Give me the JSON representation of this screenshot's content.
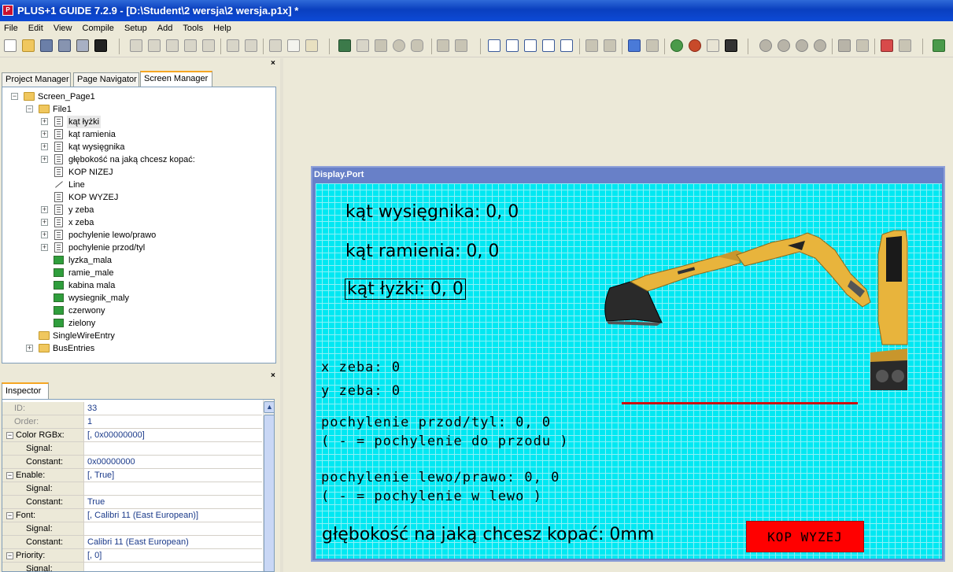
{
  "window": {
    "title": "PLUS+1 GUIDE 7.2.9  - [D:\\Student\\2 wersja\\2 wersja.p1x] *",
    "app_icon": "P"
  },
  "menu": [
    "File",
    "Edit",
    "View",
    "Compile",
    "Setup",
    "Add",
    "Tools",
    "Help"
  ],
  "panel": {
    "close_glyph": "×"
  },
  "tabs": [
    "Project Manager",
    "Page Navigator",
    "Screen Manager"
  ],
  "tree": {
    "root": "Screen_Page1",
    "file": "File1",
    "items": [
      {
        "label": "kąt łyżki",
        "icon": "text-icon",
        "expandable": true
      },
      {
        "label": "kąt ramienia",
        "icon": "text-icon",
        "expandable": true
      },
      {
        "label": "kąt wysięgnika",
        "icon": "text-icon",
        "expandable": true
      },
      {
        "label": "głębokość na jaką chcesz kopać:",
        "icon": "text-icon",
        "expandable": true
      },
      {
        "label": "KOP NIZEJ",
        "icon": "text-icon",
        "expandable": false
      },
      {
        "label": "Line",
        "icon": "line-icon",
        "expandable": false
      },
      {
        "label": "KOP WYZEJ",
        "icon": "text-icon",
        "expandable": false
      },
      {
        "label": "y zeba",
        "icon": "text-icon",
        "expandable": true
      },
      {
        "label": "x zeba",
        "icon": "text-icon",
        "expandable": true
      },
      {
        "label": "pochylenie lewo/prawo",
        "icon": "text-icon",
        "expandable": true
      },
      {
        "label": "pochylenie przod/tyl",
        "icon": "text-icon",
        "expandable": true
      },
      {
        "label": "lyzka_mala",
        "icon": "image-icon",
        "expandable": false
      },
      {
        "label": "ramie_male",
        "icon": "image-icon",
        "expandable": false
      },
      {
        "label": "kabina mala",
        "icon": "image-icon",
        "expandable": false
      },
      {
        "label": "wysiegnik_maly",
        "icon": "image-icon",
        "expandable": false
      },
      {
        "label": "czerwony",
        "icon": "image-icon",
        "expandable": false
      },
      {
        "label": "zielony",
        "icon": "image-icon",
        "expandable": false
      }
    ],
    "single_wire": "SingleWireEntry",
    "bus": "BusEntries"
  },
  "inspector": {
    "tab": "Inspector",
    "rows": [
      {
        "key": "ID:",
        "value": "33",
        "type": "grey"
      },
      {
        "key": "Order:",
        "value": "1",
        "type": "grey"
      },
      {
        "key": "Color RGBx:",
        "value": "[, 0x00000000]",
        "type": "group"
      },
      {
        "key": "Signal:",
        "value": "",
        "type": "sub"
      },
      {
        "key": "Constant:",
        "value": "0x00000000",
        "type": "sub"
      },
      {
        "key": "Enable:",
        "value": "[, True]",
        "type": "group"
      },
      {
        "key": "Signal:",
        "value": "",
        "type": "sub"
      },
      {
        "key": "Constant:",
        "value": "True",
        "type": "sub"
      },
      {
        "key": "Font:",
        "value": "[, Calibri 11  (East European)]",
        "type": "group"
      },
      {
        "key": "Signal:",
        "value": "",
        "type": "sub"
      },
      {
        "key": "Constant:",
        "value": "Calibri 11  (East European)",
        "type": "sub"
      },
      {
        "key": "Priority:",
        "value": "[, 0]",
        "type": "group"
      },
      {
        "key": "Signal:",
        "value": "",
        "type": "sub"
      }
    ]
  },
  "display": {
    "title": "Display.Port",
    "labels": {
      "wysiegnik": "kąt wysięgnika:  0, 0",
      "ramienia": "kąt ramienia:  0, 0",
      "lyzki": "kąt łyżki:  0, 0",
      "x_zeba": "x zeba:   0",
      "y_zeba": "y zeba:   0",
      "przod_tyl": "pochylenie przod/tyl:  0, 0",
      "przod_tyl_note": "( - = pochylenie do przodu )",
      "lewo_prawo": "pochylenie lewo/prawo:  0, 0",
      "lewo_prawo_note": "( - = pochylenie w lewo )",
      "glebokosc": "głębokość na jaką chcesz kopać:   0mm",
      "kop_button": "KOP WYZEJ"
    },
    "colors": {
      "canvas": "#00e8f2",
      "line": "#cc1010",
      "button": "#ff0000",
      "excavator": "#e8b43c"
    }
  }
}
